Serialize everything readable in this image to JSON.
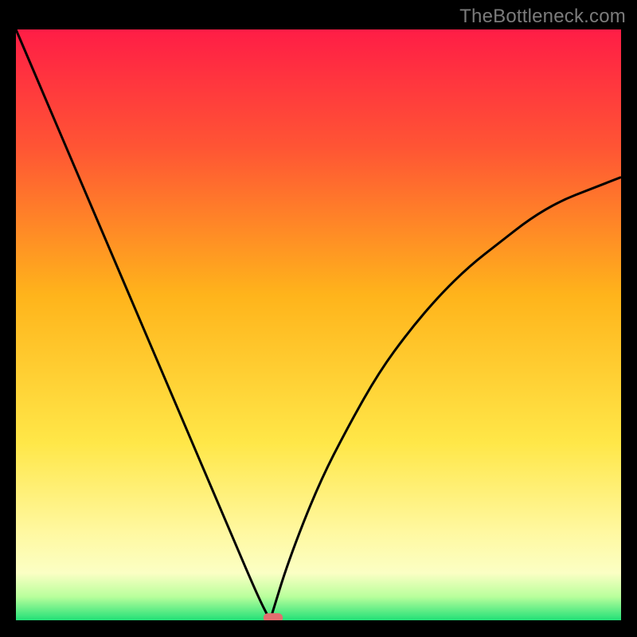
{
  "watermark": "TheBottleneck.com",
  "chart_data": {
    "type": "line",
    "title": "",
    "xlabel": "",
    "ylabel": "",
    "xlim": [
      0,
      100
    ],
    "ylim": [
      0,
      100
    ],
    "x_minimum_at": 42,
    "curve_left": {
      "x": [
        0,
        5,
        10,
        15,
        20,
        25,
        30,
        35,
        40,
        42
      ],
      "y": [
        100,
        88,
        76,
        64,
        52,
        40,
        28,
        16,
        4,
        0
      ]
    },
    "curve_right": {
      "x": [
        42,
        45,
        50,
        55,
        60,
        65,
        70,
        75,
        80,
        85,
        90,
        95,
        100
      ],
      "y": [
        0,
        10,
        23,
        33,
        42,
        49,
        55,
        60,
        64,
        68,
        71,
        73,
        75
      ]
    },
    "background_gradient_stops": [
      {
        "pct": 0,
        "color": "#ff1d46"
      },
      {
        "pct": 20,
        "color": "#ff5534"
      },
      {
        "pct": 45,
        "color": "#ffb41b"
      },
      {
        "pct": 70,
        "color": "#ffe748"
      },
      {
        "pct": 85,
        "color": "#fff8a0"
      },
      {
        "pct": 92,
        "color": "#fbffc4"
      },
      {
        "pct": 96,
        "color": "#b9ff9c"
      },
      {
        "pct": 100,
        "color": "#22e077"
      }
    ],
    "marker": {
      "x": 42.5,
      "y": 0,
      "color": "#e26f6f",
      "width_pct": 3.2,
      "height_pct": 1.6
    },
    "colors": {
      "curve": "#000000",
      "frame": "#000000"
    }
  }
}
